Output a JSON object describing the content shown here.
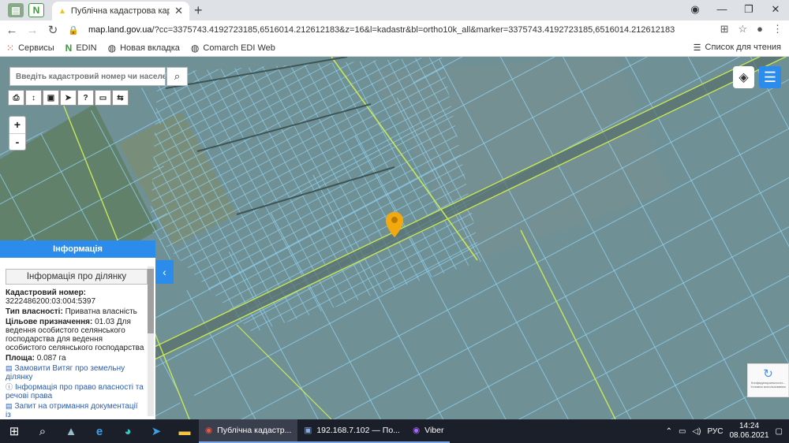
{
  "browser": {
    "tab_title": "Публічна кадастрова карта Укр",
    "url_host": "map.land.gov.ua",
    "url_path": "/?cc=3375743.4192723185,6516014.212612183&z=16&l=kadastr&bl=ortho10k_all&marker=3375743.4192723185,6516014.212612183",
    "bookmarks": [
      "Сервисы",
      "EDIN",
      "Новая вкладка",
      "Comarch EDI Web"
    ],
    "reading_list": "Список для чтения"
  },
  "search": {
    "placeholder": "Введіть кадастровий номер чи населений"
  },
  "info_panel": {
    "header": "Інформація",
    "subheader": "Інформація про ділянку",
    "cadastral_label": "Кадастровий номер:",
    "cadastral_value": "3222486200:03:004:5397",
    "ownership_label": "Тип власності:",
    "ownership_value": "Приватна власність",
    "purpose_label": "Цільове призначення:",
    "purpose_value": "01.03 Для ведення особистого селянського господарства для ведення особистого селянського господарства",
    "area_label": "Площа:",
    "area_value": "0.087 га",
    "link_extract": "Замовити Витяг про земельну ділянку",
    "link_rights": "Інформація про право власності та речові права",
    "link_request": "Запит на отримання документації із"
  },
  "recaptcha": {
    "text": "Конфиденциальность - Условия использования"
  },
  "taskbar": {
    "items": [
      {
        "label": "Публічна кадастр...",
        "icon": "chrome-icon",
        "active": true
      },
      {
        "label": "192.168.7.102 — По...",
        "icon": "remote-desktop-icon",
        "active": false
      },
      {
        "label": "Viber",
        "icon": "viber-icon",
        "active": false
      }
    ],
    "lang": "РУС",
    "time": "14:24",
    "date": "08.06.2021"
  },
  "colors": {
    "accent": "#2b8ceb",
    "parcel": "#8fd0f0",
    "road": "#c8e85a",
    "marker": "#f2a90f"
  }
}
